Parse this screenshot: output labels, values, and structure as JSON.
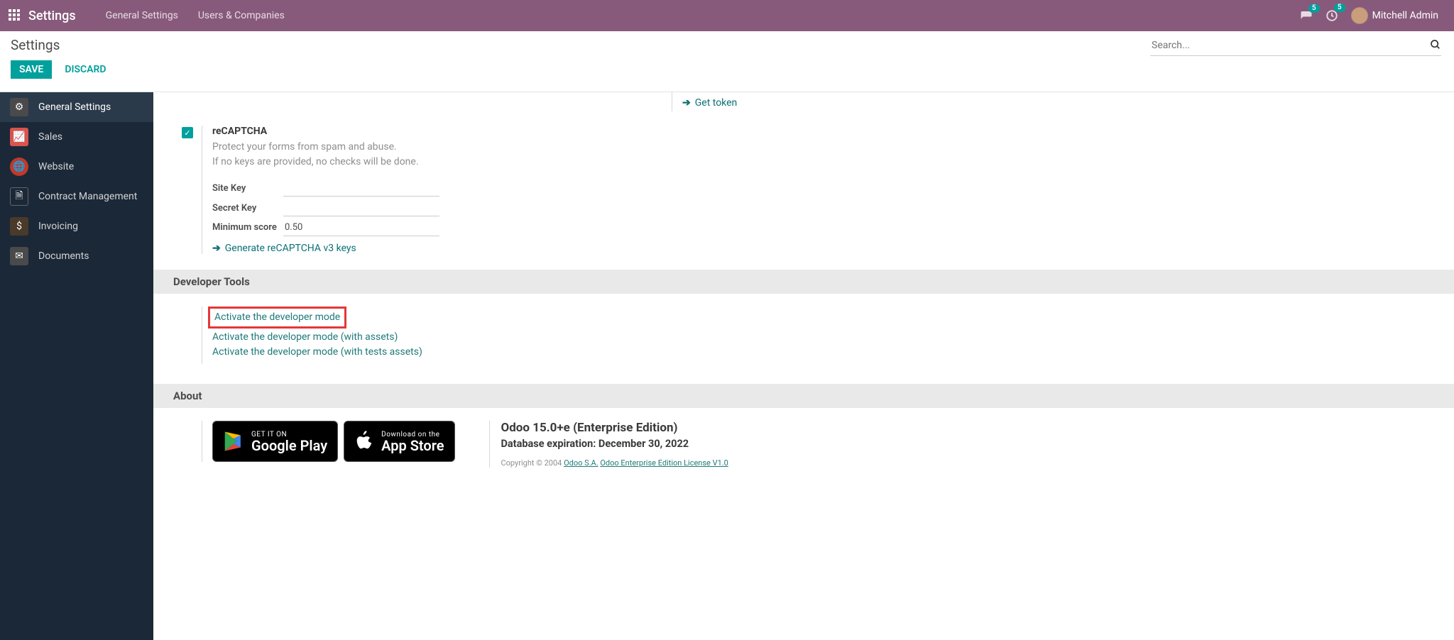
{
  "topbar": {
    "brand": "Settings",
    "menu": [
      "General Settings",
      "Users & Companies"
    ],
    "messages_badge": "5",
    "activities_badge": "5",
    "username": "Mitchell Admin"
  },
  "subbar": {
    "title": "Settings",
    "save": "SAVE",
    "discard": "DISCARD",
    "search_placeholder": "Search..."
  },
  "sidebar": {
    "items": [
      {
        "label": "General Settings",
        "icon": "gear-icon"
      },
      {
        "label": "Sales",
        "icon": "chart-icon"
      },
      {
        "label": "Website",
        "icon": "globe-icon"
      },
      {
        "label": "Contract Management",
        "icon": "document-icon"
      },
      {
        "label": "Invoicing",
        "icon": "invoice-icon"
      },
      {
        "label": "Documents",
        "icon": "folder-icon"
      }
    ]
  },
  "content": {
    "get_token": "Get token",
    "recaptcha": {
      "title": "reCAPTCHA",
      "desc1": "Protect your forms from spam and abuse.",
      "desc2": "If no keys are provided, no checks will be done.",
      "site_key_label": "Site Key",
      "secret_key_label": "Secret Key",
      "min_score_label": "Minimum score",
      "min_score_value": "0.50",
      "generate": "Generate reCAPTCHA v3 keys"
    },
    "dev_header": "Developer Tools",
    "dev_links": {
      "activate": "Activate the developer mode",
      "assets": "Activate the developer mode (with assets)",
      "tests": "Activate the developer mode (with tests assets)"
    },
    "about_header": "About",
    "google_play": {
      "small": "GET IT ON",
      "big": "Google Play"
    },
    "app_store": {
      "small": "Download on the",
      "big": "App Store"
    },
    "about": {
      "version": "Odoo 15.0+e (Enterprise Edition)",
      "expiration": "Database expiration: December 30, 2022",
      "copyright_prefix": "Copyright © 2004 ",
      "odoo_sa": "Odoo S.A.",
      "license": "Odoo Enterprise Edition License V1.0"
    }
  }
}
